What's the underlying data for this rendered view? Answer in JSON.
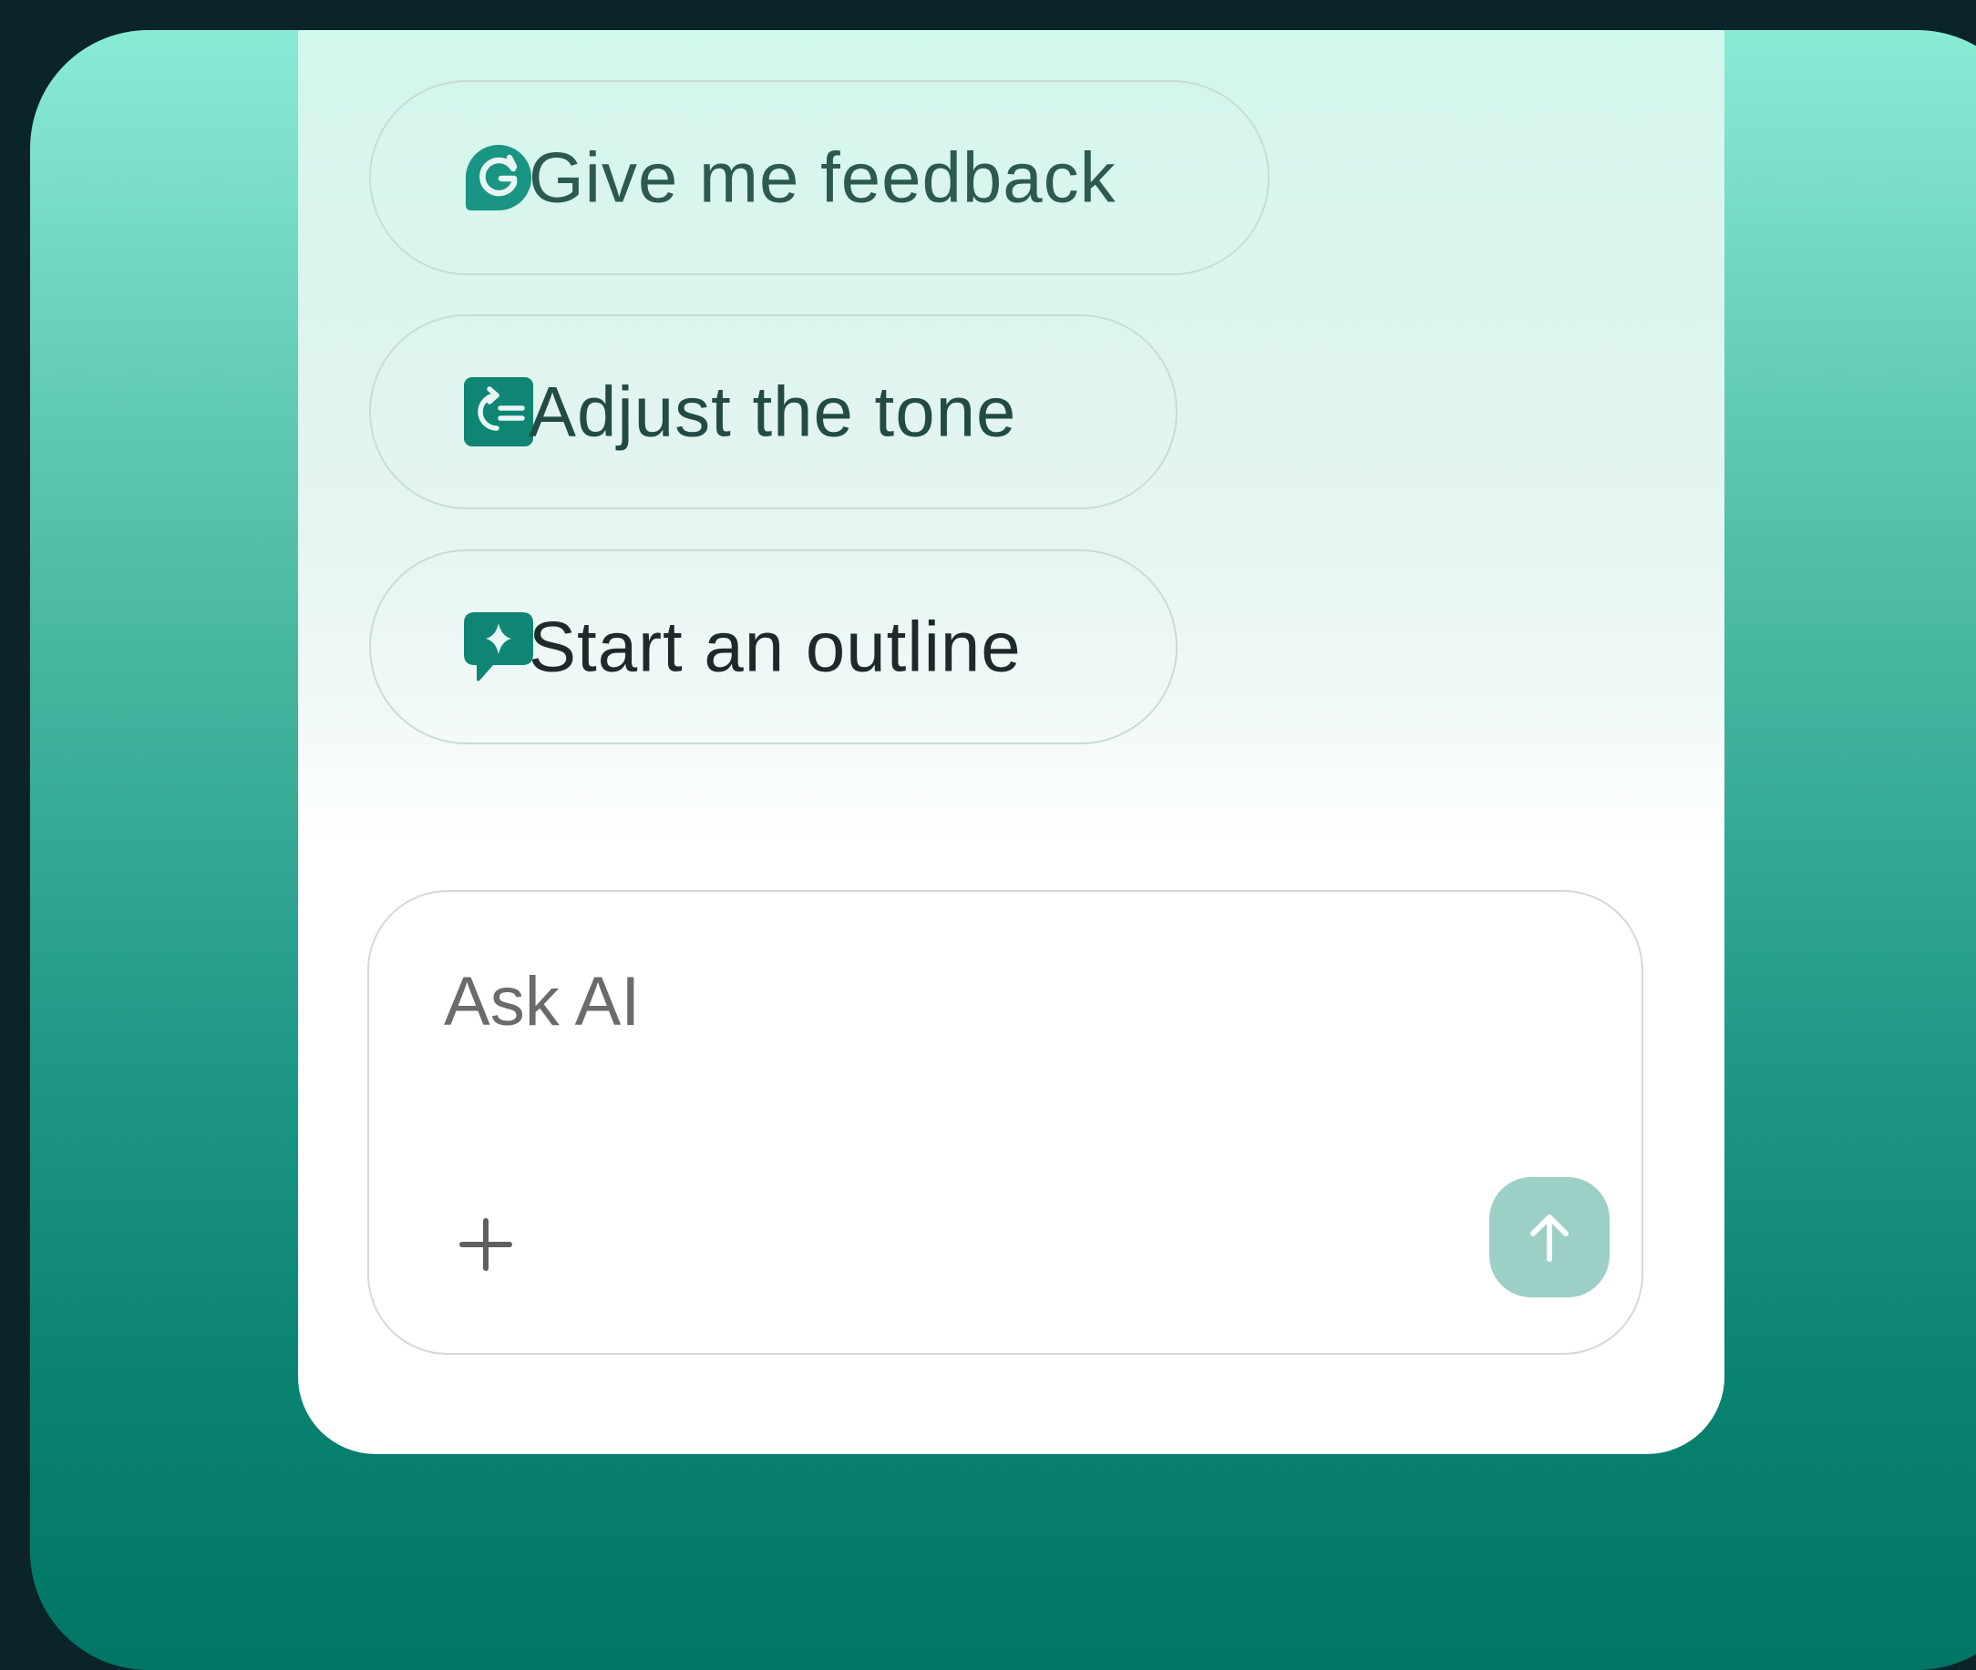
{
  "suggestions": [
    {
      "label": "Give me feedback",
      "icon": "grammarly-g-icon"
    },
    {
      "label": "Adjust the tone",
      "icon": "tone-adjust-icon"
    },
    {
      "label": "Start an outline",
      "icon": "sparkle-chat-icon"
    }
  ],
  "composer": {
    "placeholder": "Ask AI",
    "add_icon": "plus-icon",
    "send_icon": "arrow-up-icon"
  },
  "colors": {
    "accent": "#0f8574",
    "send_button": "#9ccfc6",
    "frame_top": "#8aebd5",
    "frame_bottom": "#027565",
    "background": "#0a242a"
  }
}
